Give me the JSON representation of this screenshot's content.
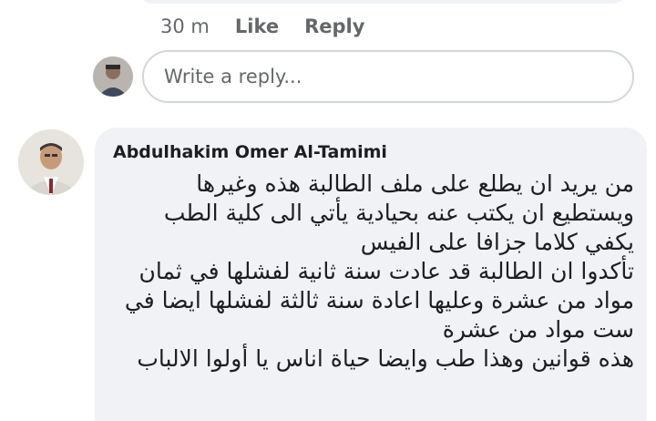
{
  "previous_comment": {
    "timestamp": "30 m",
    "like_label": "Like",
    "reply_label": "Reply"
  },
  "reply_box": {
    "placeholder": "Write a reply..."
  },
  "comment": {
    "author": "Abdulhakim Omer Al-Tamimi",
    "lines": [
      "من يريد ان يطلع على ملف الطالبة هذه وغيرها",
      "ويستطيع ان يكتب عنه بحيادية يأتي الى كلية الطب",
      "يكفي كلاما جزافا على الفيس",
      "تأكدوا ان الطالبة قد عادت سنة ثانية لفشلها في ثمان",
      "مواد من عشرة وعليها اعادة سنة ثالثة لفشلها ايضا في",
      "ست مواد من عشرة",
      "هذه قوانين وهذا طب وايضا حياة اناس يا أولوا الالباب"
    ]
  },
  "icons": {
    "reply_avatar": "user-avatar-photo",
    "comment_avatar": "commenter-avatar-photo"
  }
}
